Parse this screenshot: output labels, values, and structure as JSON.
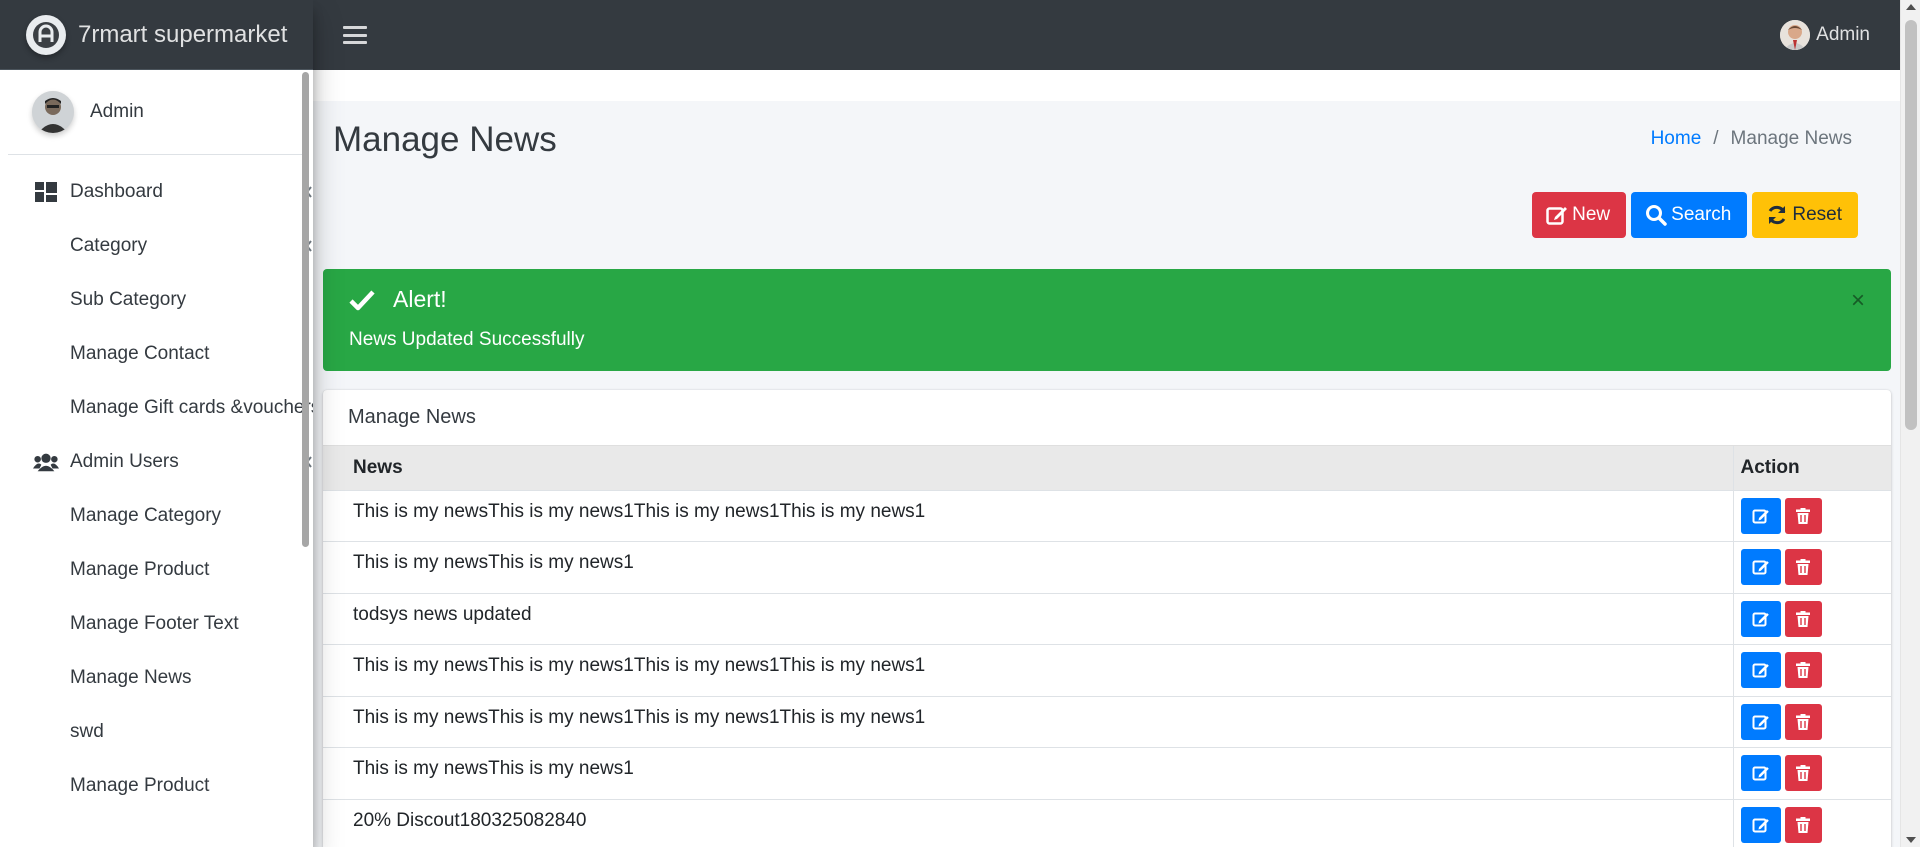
{
  "brand": {
    "name": "7rmart supermarket",
    "logo_icon": "brand-logo-icon"
  },
  "sidebar": {
    "user_name": "Admin",
    "items": [
      {
        "label": "Dashboard",
        "icon": "dashboard-icon",
        "has_caret": true
      },
      {
        "label": "Category",
        "has_caret": true
      },
      {
        "label": "Sub Category"
      },
      {
        "label": "Manage Contact"
      },
      {
        "label": "Manage Gift cards &vouchers"
      },
      {
        "label": "Admin Users",
        "icon": "users-icon",
        "has_caret": true
      },
      {
        "label": "Manage Category"
      },
      {
        "label": "Manage Product"
      },
      {
        "label": "Manage Footer Text"
      },
      {
        "label": "Manage News"
      },
      {
        "label": "swd"
      },
      {
        "label": "Manage Product"
      }
    ]
  },
  "topbar": {
    "user_name": "Admin"
  },
  "page": {
    "title": "Manage News",
    "breadcrumb": {
      "home": "Home",
      "separator": "/",
      "current": "Manage News"
    },
    "buttons": {
      "new": "New",
      "search": "Search",
      "reset": "Reset"
    }
  },
  "alert": {
    "title": "Alert!",
    "message": "News Updated Successfully",
    "close": "×"
  },
  "table": {
    "card_title": "Manage News",
    "columns": [
      "News",
      "Action"
    ],
    "rows": [
      "This is my newsThis is my news1This is my news1This is my news1",
      "This is my newsThis is my news1",
      "todsys news updated",
      "This is my newsThis is my news1This is my news1This is my news1",
      "This is my newsThis is my news1This is my news1This is my news1",
      "This is my newsThis is my news1",
      "20% Discout180325082840"
    ]
  },
  "colors": {
    "navbar": "#343a40",
    "success": "#28a745",
    "primary": "#007bff",
    "danger": "#dc3545",
    "warning": "#ffc107"
  }
}
